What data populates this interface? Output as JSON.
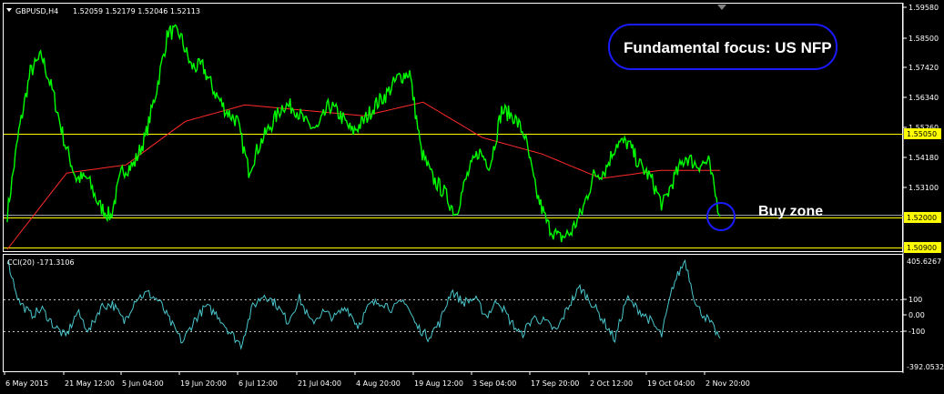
{
  "chart_header": {
    "menu_arrow": "triangle-down-icon",
    "symbol": "GBPUSD,H4",
    "ohlc": "1.52059 1.52179 1.52046 1.52113"
  },
  "annotations": {
    "title": "Fundamental focus: US NFP",
    "buy_zone": "Buy zone"
  },
  "colors": {
    "price": "#00ff00",
    "moving_average": "#ff2a2a",
    "resistance": "#ffff00",
    "support": "#ffff00",
    "cci": "#49c6cc",
    "callout_border": "#1a1aff",
    "buy_circle": "#1a1aff"
  },
  "price_axis": {
    "ticks": [
      "1.59580",
      "1.58500",
      "1.57420",
      "1.56340",
      "1.55260",
      "1.54180",
      "1.53100"
    ],
    "highlight_labels": [
      "1.55050",
      "1.52000",
      "1.50900"
    ]
  },
  "cci_panel": {
    "label": "CCI(20) -171.3106",
    "ticks": [
      "405.6267",
      "100",
      "0.00",
      "-100",
      "-392.0532"
    ]
  },
  "time_axis": {
    "labels": [
      "6 May 2015",
      "21 May 12:00",
      "5 Jun 04:00",
      "19 Jun 20:00",
      "6 Jul 12:00",
      "21 Jul 04:00",
      "4 Aug 20:00",
      "19 Aug 12:00",
      "3 Sep 04:00",
      "17 Sep 20:00",
      "2 Oct 12:00",
      "19 Oct 04:00",
      "2 Nov 20:00"
    ]
  },
  "chart_data": {
    "type": "line",
    "instrument": "GBPUSD",
    "timeframe": "H4",
    "ylim": [
      1.509,
      1.5985
    ],
    "levels": [
      1.5505,
      1.52,
      1.509
    ],
    "price_keypoints": [
      [
        "6 May 2015",
        1.522
      ],
      [
        "8 May",
        1.552
      ],
      [
        "12 May",
        1.574
      ],
      [
        "15 May",
        1.58
      ],
      [
        "18 May",
        1.566
      ],
      [
        "20 May",
        1.548
      ],
      [
        "21 May 12:00",
        1.535
      ],
      [
        "26 May",
        1.535
      ],
      [
        "29 May",
        1.525
      ],
      [
        "2 Jun",
        1.521
      ],
      [
        "5 Jun 04:00",
        1.538
      ],
      [
        "8 Jun",
        1.54
      ],
      [
        "11 Jun",
        1.55
      ],
      [
        "15 Jun",
        1.568
      ],
      [
        "18 Jun",
        1.589
      ],
      [
        "19 Jun 20:00",
        1.588
      ],
      [
        "23 Jun",
        1.576
      ],
      [
        "26 Jun",
        1.576
      ],
      [
        "30 Jun",
        1.567
      ],
      [
        "3 Jul",
        1.56
      ],
      [
        "6 Jul 12:00",
        1.556
      ],
      [
        "8 Jul",
        1.538
      ],
      [
        "10 Jul",
        1.548
      ],
      [
        "14 Jul",
        1.555
      ],
      [
        "17 Jul",
        1.562
      ],
      [
        "21 Jul 04:00",
        1.561
      ],
      [
        "24 Jul",
        1.555
      ],
      [
        "28 Jul",
        1.553
      ],
      [
        "31 Jul",
        1.562
      ],
      [
        "4 Aug 20:00",
        1.558
      ],
      [
        "7 Aug",
        1.552
      ],
      [
        "11 Aug",
        1.556
      ],
      [
        "14 Aug",
        1.562
      ],
      [
        "17 Aug",
        1.566
      ],
      [
        "19 Aug 12:00",
        1.572
      ],
      [
        "21 Aug",
        1.574
      ],
      [
        "25 Aug",
        1.545
      ],
      [
        "27 Aug",
        1.535
      ],
      [
        "1 Sep",
        1.53
      ],
      [
        "3 Sep 04:00",
        1.522
      ],
      [
        "7 Sep",
        1.536
      ],
      [
        "10 Sep",
        1.545
      ],
      [
        "14 Sep",
        1.54
      ],
      [
        "16 Sep",
        1.56
      ],
      [
        "17 Sep 20:00",
        1.558
      ],
      [
        "21 Sep",
        1.551
      ],
      [
        "24 Sep",
        1.53
      ],
      [
        "28 Sep",
        1.518
      ],
      [
        "30 Sep",
        1.513
      ],
      [
        "2 Oct 12:00",
        1.515
      ],
      [
        "6 Oct",
        1.523
      ],
      [
        "9 Oct",
        1.536
      ],
      [
        "13 Oct",
        1.538
      ],
      [
        "15 Oct",
        1.548
      ],
      [
        "19 Oct 04:00",
        1.548
      ],
      [
        "21 Oct",
        1.54
      ],
      [
        "23 Oct",
        1.535
      ],
      [
        "27 Oct",
        1.525
      ],
      [
        "29 Oct",
        1.535
      ],
      [
        "2 Nov",
        1.543
      ],
      [
        "2 Nov 20:00",
        1.54
      ],
      [
        "5 Nov",
        1.541
      ],
      [
        "6 Nov",
        1.52113
      ]
    ],
    "ma_keypoints": [
      [
        "6 May 2015",
        1.509
      ],
      [
        "21 May 12:00",
        1.537
      ],
      [
        "5 Jun 04:00",
        1.54
      ],
      [
        "19 Jun 20:00",
        1.556
      ],
      [
        "6 Jul 12:00",
        1.562
      ],
      [
        "21 Jul 04:00",
        1.56
      ],
      [
        "4 Aug 20:00",
        1.558
      ],
      [
        "19 Aug 12:00",
        1.563
      ],
      [
        "3 Sep 04:00",
        1.55
      ],
      [
        "17 Sep 20:00",
        1.544
      ],
      [
        "2 Oct 12:00",
        1.535
      ],
      [
        "19 Oct 04:00",
        1.538
      ],
      [
        "2 Nov 20:00",
        1.538
      ]
    ],
    "cci_keypoints": [
      [
        "6 May 2015",
        405
      ],
      [
        "8 May",
        100
      ],
      [
        "12 May",
        0
      ],
      [
        "15 May",
        40
      ],
      [
        "18 May",
        -80
      ],
      [
        "21 May 12:00",
        -160
      ],
      [
        "26 May",
        20
      ],
      [
        "29 May",
        -120
      ],
      [
        "2 Jun",
        60
      ],
      [
        "5 Jun 04:00",
        80
      ],
      [
        "8 Jun",
        -50
      ],
      [
        "11 Jun",
        120
      ],
      [
        "15 Jun",
        160
      ],
      [
        "18 Jun",
        100
      ],
      [
        "19 Jun 20:00",
        -60
      ],
      [
        "23 Jun",
        -200
      ],
      [
        "26 Jun",
        -40
      ],
      [
        "30 Jun",
        60
      ],
      [
        "3 Jul",
        0
      ],
      [
        "6 Jul 12:00",
        -120
      ],
      [
        "8 Jul",
        -220
      ],
      [
        "10 Jul",
        60
      ],
      [
        "14 Jul",
        150
      ],
      [
        "17 Jul",
        80
      ],
      [
        "21 Jul 04:00",
        -50
      ],
      [
        "24 Jul",
        120
      ],
      [
        "28 Jul",
        -60
      ],
      [
        "31 Jul",
        20
      ],
      [
        "4 Aug 20:00",
        -20
      ],
      [
        "7 Aug",
        60
      ],
      [
        "11 Aug",
        -80
      ],
      [
        "14 Aug",
        70
      ],
      [
        "17 Aug",
        100
      ],
      [
        "19 Aug 12:00",
        40
      ],
      [
        "21 Aug",
        110
      ],
      [
        "25 Aug",
        -80
      ],
      [
        "27 Aug",
        -160
      ],
      [
        "1 Sep",
        -60
      ],
      [
        "3 Sep 04:00",
        180
      ],
      [
        "7 Sep",
        90
      ],
      [
        "10 Sep",
        120
      ],
      [
        "14 Sep",
        -10
      ],
      [
        "16 Sep",
        110
      ],
      [
        "17 Sep 20:00",
        -40
      ],
      [
        "21 Sep",
        -150
      ],
      [
        "24 Sep",
        -20
      ],
      [
        "28 Sep",
        -50
      ],
      [
        "30 Sep",
        -120
      ],
      [
        "2 Oct 12:00",
        60
      ],
      [
        "6 Oct",
        200
      ],
      [
        "9 Oct",
        90
      ],
      [
        "13 Oct",
        -40
      ],
      [
        "15 Oct",
        -180
      ],
      [
        "19 Oct 04:00",
        120
      ],
      [
        "21 Oct",
        40
      ],
      [
        "23 Oct",
        -40
      ],
      [
        "27 Oct",
        -150
      ],
      [
        "29 Oct",
        220
      ],
      [
        "2 Nov",
        400
      ],
      [
        "2 Nov 20:00",
        60
      ],
      [
        "5 Nov",
        -40
      ],
      [
        "6 Nov",
        -171.3106
      ]
    ],
    "cci_ylim": [
      -392.0532,
      405.6267
    ]
  }
}
